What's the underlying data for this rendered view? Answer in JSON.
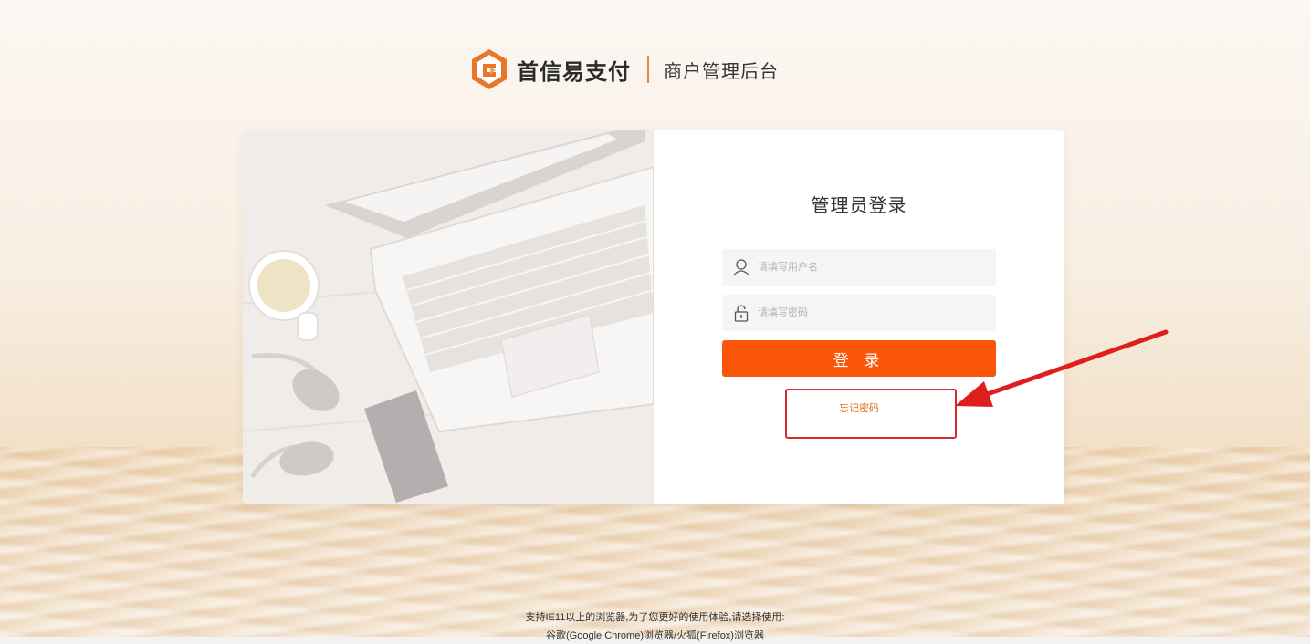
{
  "header": {
    "brand_name": "首信易支付",
    "subtitle": "商户管理后台"
  },
  "login": {
    "title": "管理员登录",
    "username_placeholder": "请填写用户名",
    "password_placeholder": "请填写密码",
    "submit_label": "登 录",
    "forgot_label": "忘记密码"
  },
  "footer": {
    "line1": "支持IE11以上的浏览器,为了您更好的使用体验,请选择使用:",
    "line2": "谷歌(Google Chrome)浏览器/火狐(Firefox)浏览器"
  },
  "colors": {
    "accent": "#fb5509",
    "brand_orange": "#e3863a",
    "annotation_red": "#d82a2a"
  },
  "icons": {
    "brand": "brand-logo-icon",
    "username": "user-icon",
    "password": "lock-icon"
  }
}
